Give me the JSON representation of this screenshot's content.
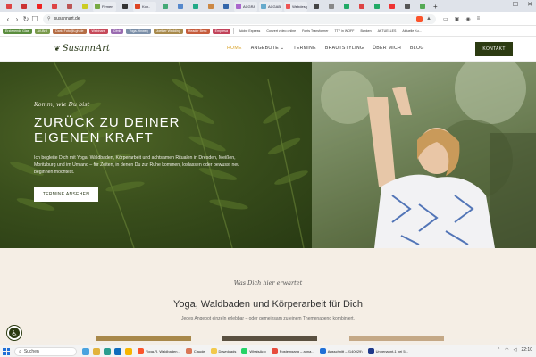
{
  "browser": {
    "tabs": [
      {
        "color": "#d44"
      },
      {
        "color": "#c33"
      },
      {
        "color": "#e22"
      },
      {
        "color": "#d44"
      },
      {
        "color": "#b55"
      },
      {
        "color": "#cc2"
      },
      {
        "color": "#7a4",
        "label": "Firmen"
      },
      {
        "color": "#333"
      },
      {
        "color": "#d42",
        "label": "Kon.."
      },
      {
        "color": "#4a7"
      },
      {
        "color": "#58c"
      },
      {
        "color": "#2a8"
      },
      {
        "color": "#c84"
      },
      {
        "color": "#36a"
      },
      {
        "color": "#a6c",
        "label": "ACGRA"
      },
      {
        "color": "#6ac",
        "label": "ACGAB"
      },
      {
        "color": "#e55",
        "label": "Webdesign"
      },
      {
        "color": "#444"
      },
      {
        "color": "#888"
      },
      {
        "color": "#2a6"
      },
      {
        "color": "#d44"
      },
      {
        "color": "#2a6"
      },
      {
        "color": "#e33"
      },
      {
        "color": "#555"
      },
      {
        "color": "#5a5"
      }
    ],
    "url": "susannart.de",
    "window_controls": [
      "—",
      "☐",
      "✕"
    ]
  },
  "bookmarks": [
    {
      "label": "Erziehende Glas",
      "bg": "#5b8d3e"
    },
    {
      "label": "AV-Brill",
      "bg": "#7a9a4c"
    },
    {
      "label": "Dark. Foto@Lgh.de",
      "bg": "#b56d45"
    },
    {
      "label": "Webinare",
      "bg": "#c64a5a"
    },
    {
      "label": "Cfmb",
      "bg": "#9a6bb0"
    },
    {
      "label": "Yoga-Hinweg",
      "bg": "#7b8fa8"
    },
    {
      "label": "Joether Wedding",
      "bg": "#a88a4c"
    },
    {
      "label": "Header Besc",
      "bg": "#c65c3c"
    },
    {
      "label": "Empresa",
      "bg": "#c2435a"
    },
    {
      "label": "Adobe Express",
      "bg": "",
      "plain": true
    },
    {
      "label": "Convert video online",
      "bg": "",
      "plain": true
    },
    {
      "label": "Fonts Transformer",
      "bg": "",
      "plain": true
    },
    {
      "label": "TTF in WOFF",
      "bg": "",
      "plain": true
    },
    {
      "label": "Banken",
      "bg": "",
      "plain": true
    },
    {
      "label": "AKTUELLES",
      "bg": "",
      "plain": true
    },
    {
      "label": "Aktuelle Ku...",
      "bg": "",
      "plain": true
    }
  ],
  "site": {
    "logo": "SusannArt",
    "nav": [
      "HOME",
      "ANGEBOTE ⌄",
      "TERMINE",
      "BRAUTSTYLING",
      "ÜBER MICH",
      "BLOG"
    ],
    "cta": "KONTAKT"
  },
  "hero": {
    "script": "Komm, wie Du bist",
    "title_line1": "ZURÜCK ZU DEINER",
    "title_line2": "EIGENEN KRAFT",
    "description": "Ich begleite Dich mit Yoga, Waldbaden, Körperarbeit und achtsamen Ritualen in Dresden, Meißen, Moritzburg und im Umland – für Zeiten, in denen Du zur Ruhe kommen, loslassen oder bewusst neu beginnen möchtest.",
    "button": "TERMINE ANSEHEN"
  },
  "intro": {
    "script": "Was Dich hier erwartet",
    "title": "Yoga, Waldbaden und Körperarbeit für Dich",
    "subtitle": "Jedes Angebot einzeln erlebbar – oder gemeinsam zu einem Themenabend kombiniert."
  },
  "taskbar": {
    "search": "Suchen",
    "apps": [
      {
        "label": "Yoga-R, Waldbaden...",
        "color": "#fb542b"
      },
      {
        "label": "Claude",
        "color": "#d97757"
      },
      {
        "label": "Downloads",
        "color": "#f2c94c"
      },
      {
        "label": "WhatsApp",
        "color": "#25d366"
      },
      {
        "label": "Posteingang – anna...",
        "color": "#e74c3c"
      },
      {
        "label": "Ausschnitt – (140029)",
        "color": "#1f6fd6"
      },
      {
        "label": "Unbenannt-1 bei 5...",
        "color": "#1f3a8a"
      }
    ],
    "time": "22:10"
  }
}
